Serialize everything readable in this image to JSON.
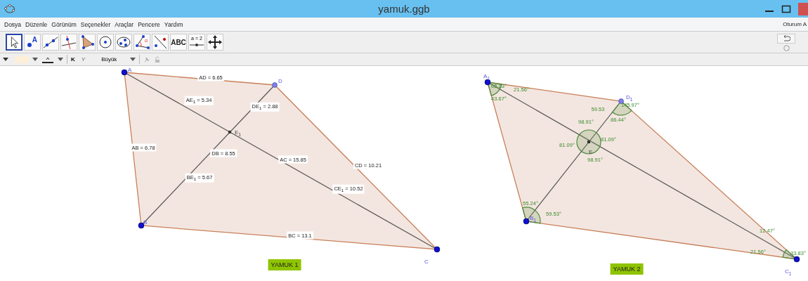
{
  "window": {
    "title": "yamuk.ggb"
  },
  "menu": [
    "Dosya",
    "Düzenle",
    "Görünüm",
    "Seçenekler",
    "Araçlar",
    "Pencere",
    "Yardım"
  ],
  "session": "Oturum A",
  "tools": [
    {
      "kind": "move",
      "selected": true
    },
    {
      "kind": "point",
      "selected": false,
      "label": "A"
    },
    {
      "kind": "line",
      "selected": false
    },
    {
      "kind": "perpendicular",
      "selected": false
    },
    {
      "kind": "polygon",
      "selected": false
    },
    {
      "kind": "circle",
      "selected": false
    },
    {
      "kind": "ellipse",
      "selected": false
    },
    {
      "kind": "angle",
      "selected": false,
      "label": "α"
    },
    {
      "kind": "reflect",
      "selected": false
    },
    {
      "kind": "text",
      "selected": false,
      "label": "ABC"
    },
    {
      "kind": "slider",
      "selected": false,
      "label": "a = 2"
    },
    {
      "kind": "pan",
      "selected": false
    }
  ],
  "style_bar": {
    "bold": "K",
    "italic": "Y",
    "size": "Büyük"
  },
  "figures": [
    {
      "caption": "YAMUK 1",
      "vertices": [
        "A",
        "D",
        "C",
        "B",
        "E$_{1}$"
      ],
      "labels": [
        "AD = 6.65",
        "AE$_{1}$ = 5.34",
        "DE$_{1}$ = 2.88",
        "AB = 6.78",
        "DB = 8.55",
        "AC = 15.85",
        "CD = 10.21",
        "BE$_{1}$ = 5.67",
        "CE$_{1}$ = 10.52",
        "BC = 13.1"
      ]
    },
    {
      "caption": "YAMUK 2",
      "vertices": [
        "A$_{1}$",
        "D$_{1}$",
        "C$_{1}$",
        "B$_{1}$",
        "E"
      ],
      "labels": [
        "65.23°",
        "21.56°",
        "43.67°",
        "59.53",
        "145.97°",
        "86.44°",
        "98.91°",
        "81.09°",
        "81.09°",
        "98.91°",
        "55.24°",
        "59.53°",
        "12.47°",
        "21.56°",
        "33.83°"
      ]
    }
  ]
}
